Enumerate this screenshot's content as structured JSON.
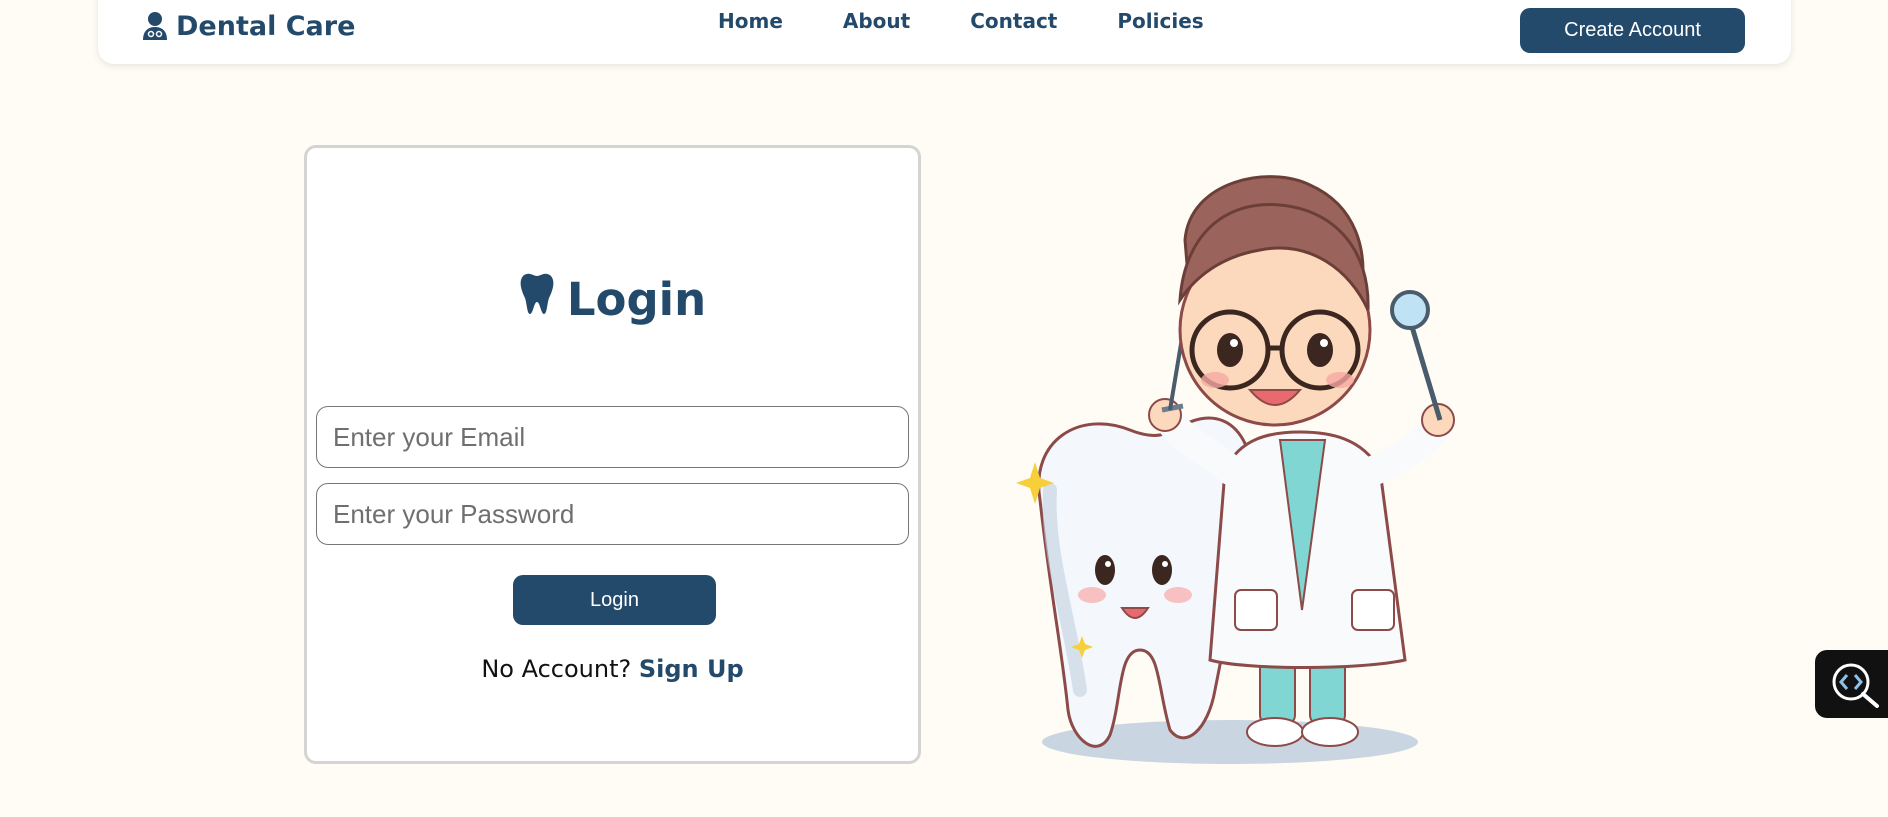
{
  "header": {
    "brand": "Dental Care",
    "brand_icon": "doctor-icon",
    "nav": [
      "Home",
      "About",
      "Contact",
      "Policies"
    ],
    "create_account": "Create Account"
  },
  "login": {
    "title": "Login",
    "title_icon": "tooth-icon",
    "email_placeholder": "Enter your Email",
    "password_placeholder": "Enter your Password",
    "button": "Login",
    "no_account": "No Account?",
    "sign_up": "Sign Up"
  },
  "floating_tool": {
    "icon": "code-search-icon"
  },
  "colors": {
    "primary": "#234a6b",
    "background": "#fffcf5",
    "card_border": "#d4d4d4"
  }
}
